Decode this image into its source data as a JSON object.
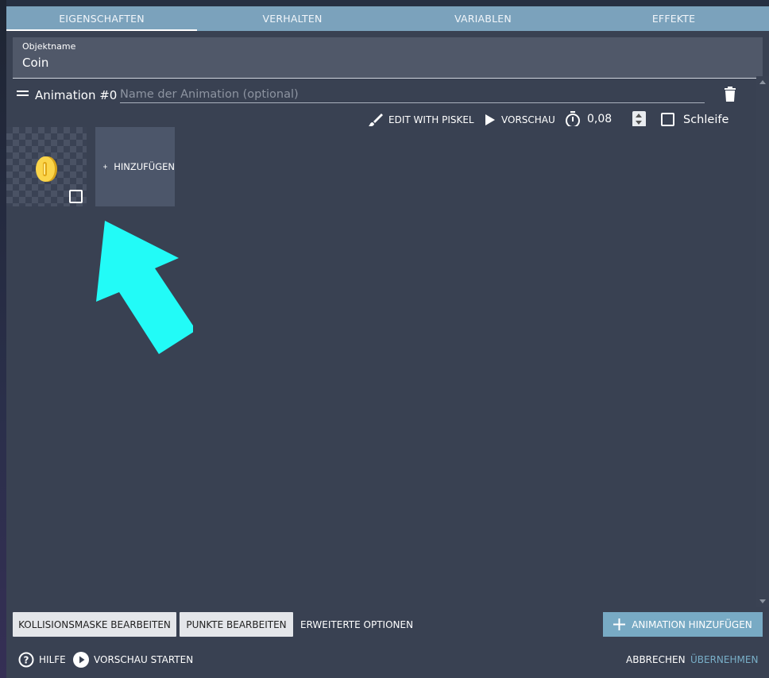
{
  "tabs": [
    {
      "label": "EIGENSCHAFTEN",
      "active": true
    },
    {
      "label": "VERHALTEN",
      "active": false
    },
    {
      "label": "VARIABLEN",
      "active": false
    },
    {
      "label": "EFFEKTE",
      "active": false
    }
  ],
  "object_name": {
    "label": "Objektname",
    "value": "Coin"
  },
  "animation": {
    "title": "Animation #0",
    "name_placeholder": "Name der Animation (optional)",
    "name_value": ""
  },
  "toolbar": {
    "edit_with_piskel": "EDIT WITH PISKEL",
    "preview": "VORSCHAU",
    "fps_value": "0,08",
    "loop_label": "Schleife",
    "loop_checked": false
  },
  "frames": [
    {
      "icon": "coin-sprite",
      "selected": false
    }
  ],
  "add_frame_label": "HINZUFÜGEN",
  "bottom_bar": {
    "edit_collision": "KOLLISIONSMASKE BEARBEITEN",
    "edit_points": "PUNKTE BEARBEITEN",
    "advanced": "ERWEITERTE OPTIONEN",
    "add_animation": "ANIMATION HINZUFÜGEN"
  },
  "footer": {
    "help": "HILFE",
    "start_preview": "VORSCHAU STARTEN",
    "cancel": "ABBRECHEN",
    "apply": "ÜBERNEHMEN"
  },
  "colors": {
    "dialog_bg": "#394152",
    "tab_bar": "#7ba2bc",
    "primary_button": "#78aac4",
    "accent_text": "#79afc8",
    "highlight_arrow": "#22fbf7"
  }
}
